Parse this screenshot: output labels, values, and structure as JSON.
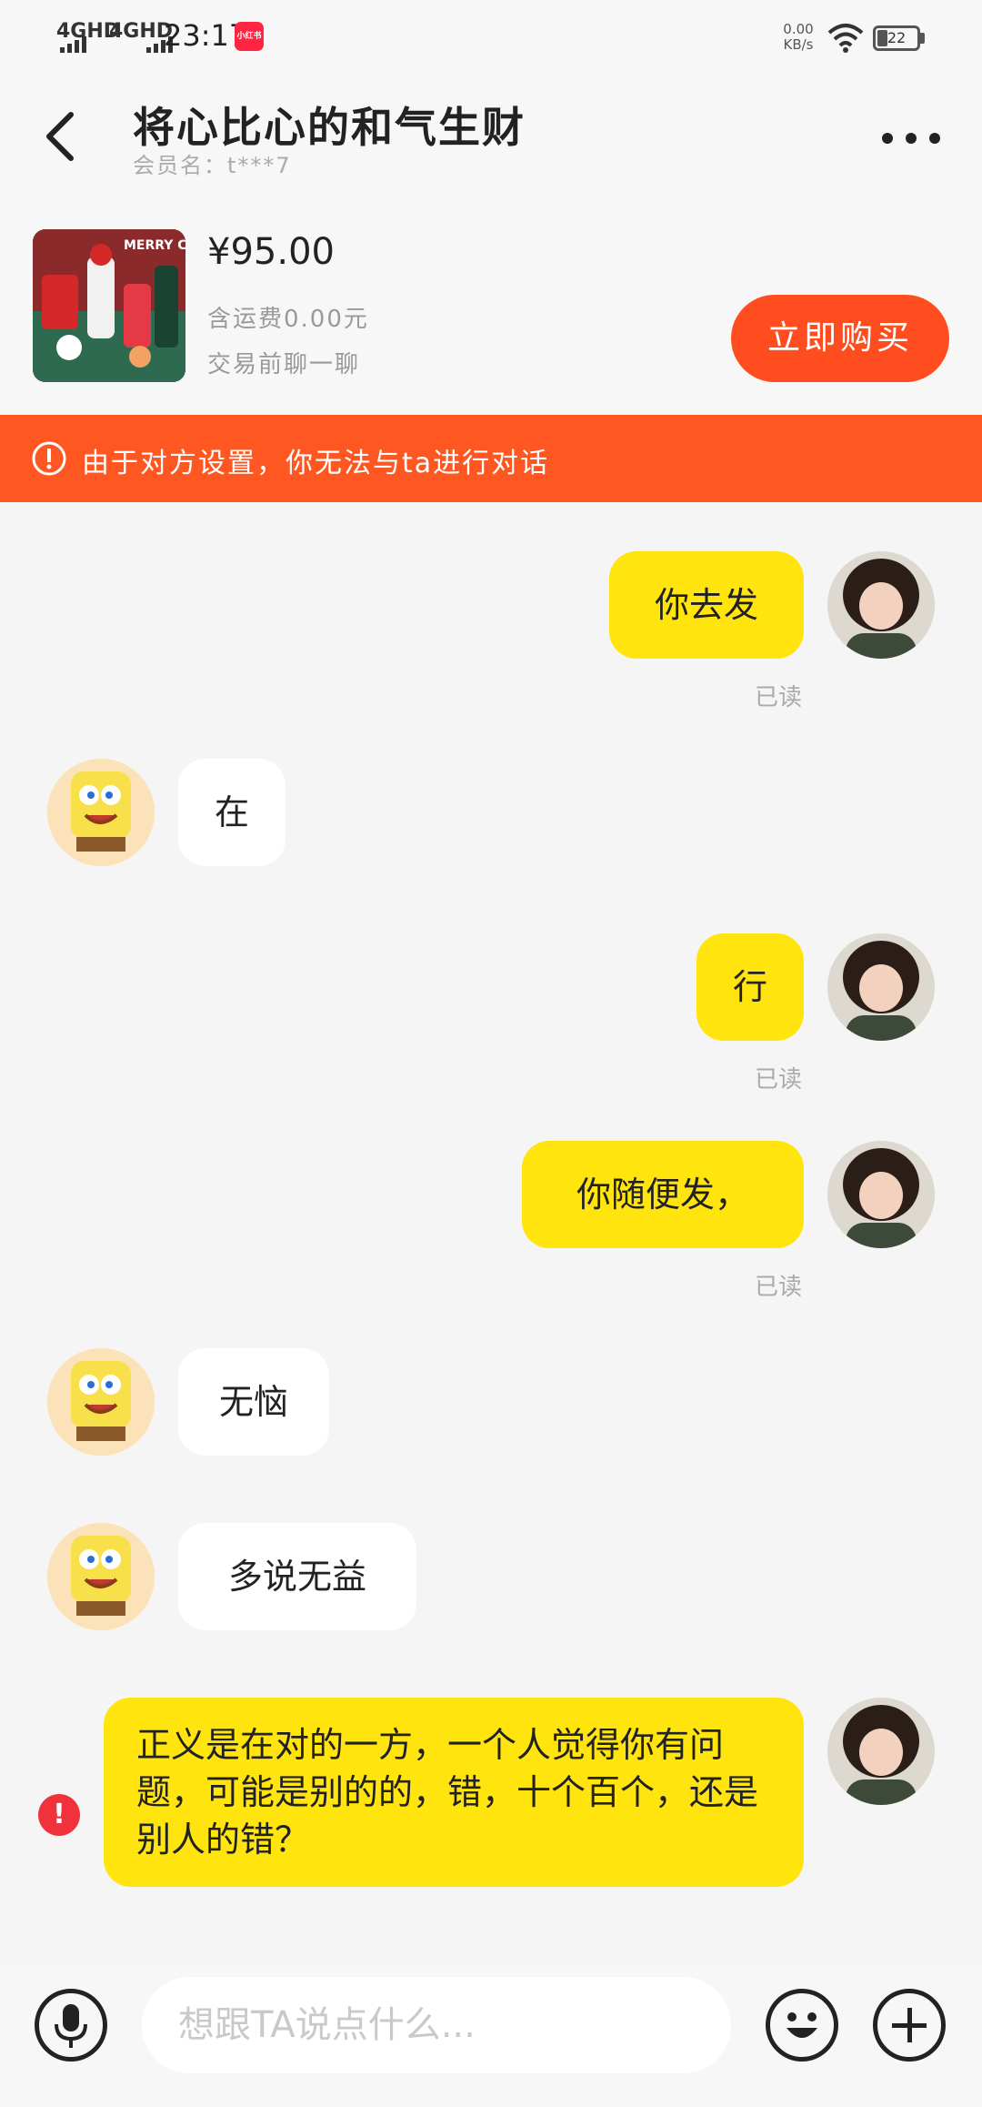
{
  "status_bar": {
    "signal1": "4GHD",
    "signal2": "4GHD",
    "time": "23:17",
    "app_badge": "小红书",
    "net_speed_value": "0.00",
    "net_speed_unit": "KB/s",
    "battery": "22"
  },
  "header": {
    "title": "将心比心的和气生财",
    "member_label": "会员名：t***7"
  },
  "product": {
    "price": "¥95.00",
    "shipping": "含运费0.00元",
    "pre_chat": "交易前聊一聊",
    "buy_label": "立即购买",
    "thumb_caption": "MERRY CHRISTMAS"
  },
  "notice": {
    "text": "由于对方设置，你无法与ta进行对话"
  },
  "messages": [
    {
      "side": "me",
      "text": "你去发",
      "read": "已读"
    },
    {
      "side": "them",
      "text": "在"
    },
    {
      "side": "me",
      "text": "行",
      "read": "已读"
    },
    {
      "side": "me",
      "text": "你随便发，",
      "read": "已读"
    },
    {
      "side": "them",
      "text": "无恼"
    },
    {
      "side": "them",
      "text": "多说无益"
    },
    {
      "side": "me",
      "text": "正义是在对的一方，一个人觉得你有问题，可能是别的的，错，十个百个，还是别人的错？",
      "failed": true
    }
  ],
  "input": {
    "placeholder": "想跟TA说点什么..."
  },
  "icons": {
    "back": "back-arrow-icon",
    "more": "more-dots-icon",
    "warning": "warning-icon",
    "voice": "microphone-icon",
    "emoji": "emoji-icon",
    "plus": "plus-icon",
    "send_failed": "send-failed-icon"
  },
  "colors": {
    "accent": "#ff4d1f",
    "notice": "#ff5722",
    "my_bubble": "#ffe40d",
    "error": "#f0323c"
  }
}
